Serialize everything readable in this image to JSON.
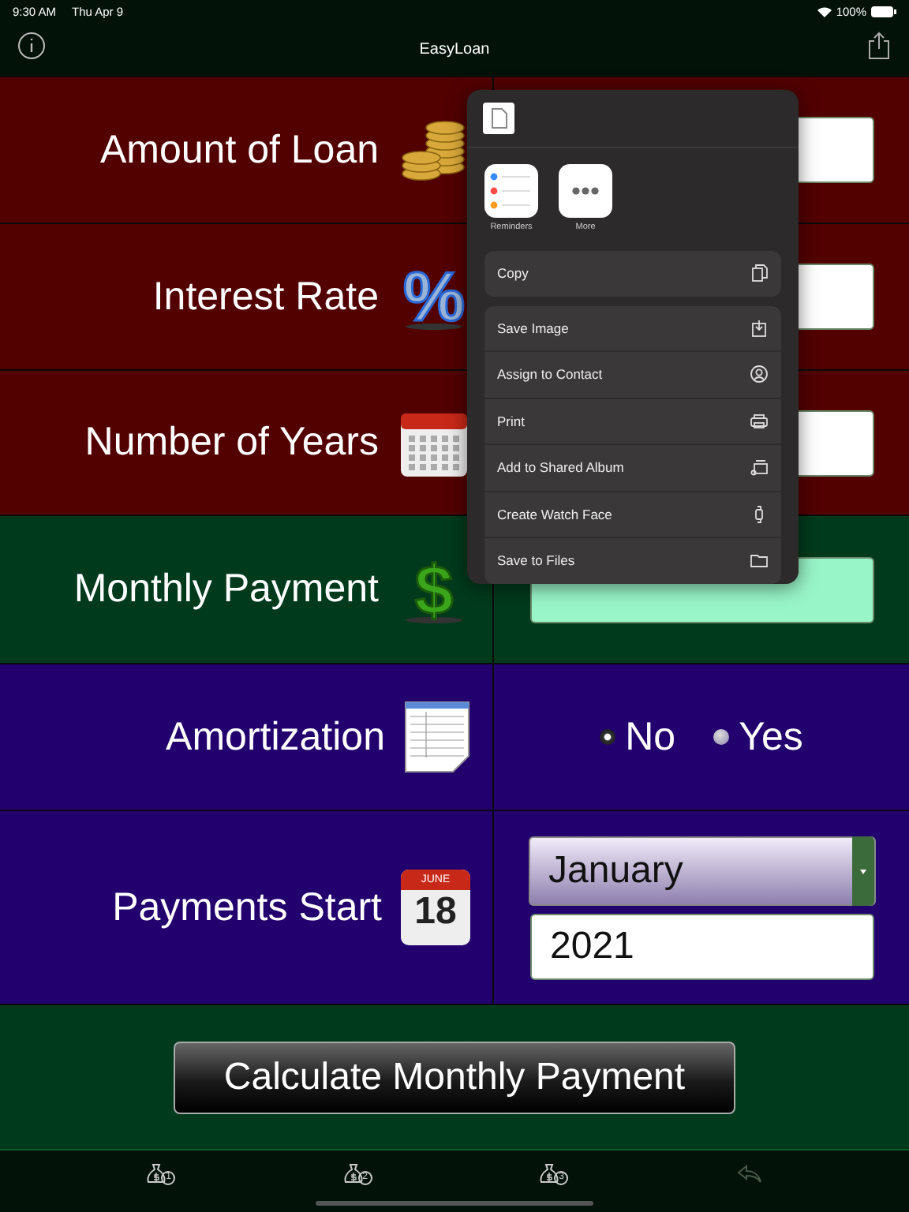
{
  "status_bar": {
    "time": "9:30 AM",
    "date": "Thu Apr 9",
    "battery": "100%"
  },
  "nav_bar": {
    "title": "EasyLoan"
  },
  "rows": [
    {
      "kind": "input",
      "label": "Amount of Loan"
    },
    {
      "kind": "input",
      "label": "Interest Rate",
      "glyph": "%"
    },
    {
      "kind": "input",
      "label": "Number of Years"
    },
    {
      "kind": "output",
      "label": "Monthly Payment",
      "glyph": "$"
    },
    {
      "kind": "radio",
      "label": "Amortization",
      "options": [
        {
          "label": "No",
          "selected": true
        },
        {
          "label": "Yes",
          "selected": false
        }
      ]
    },
    {
      "kind": "date",
      "label": "Payments Start",
      "icon_month": "JUNE",
      "icon_day": "18",
      "month": "January",
      "year": "2021"
    }
  ],
  "calculate_button": "Calculate Monthly Payment",
  "tab_bar": [
    {
      "label": "1",
      "disabled": false
    },
    {
      "label": "2",
      "disabled": false
    },
    {
      "label": "3",
      "disabled": false
    },
    {
      "kind": "undo",
      "disabled": true
    }
  ],
  "share_sheet": {
    "apps": [
      {
        "label": "Reminders",
        "kind": "reminders"
      },
      {
        "label": "More",
        "kind": "more"
      }
    ],
    "copy_action": {
      "label": "Copy"
    },
    "actions": [
      {
        "label": "Save Image"
      },
      {
        "label": "Assign to Contact"
      },
      {
        "label": "Print"
      },
      {
        "label": "Add to Shared Album"
      },
      {
        "label": "Create Watch Face"
      },
      {
        "label": "Save to Files"
      }
    ]
  }
}
